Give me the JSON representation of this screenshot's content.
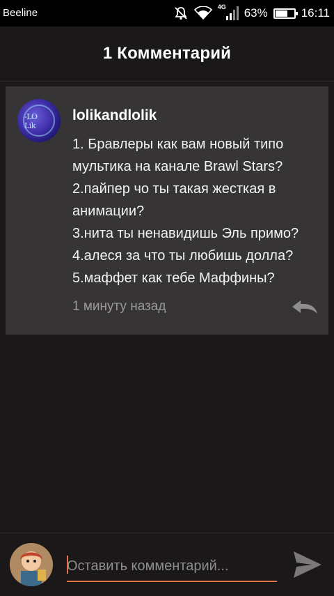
{
  "status_bar": {
    "carrier": "Beeline",
    "network_label": "4G",
    "battery_percent": "63%",
    "battery_level": 0.63,
    "time": "16:11",
    "icons": [
      "mute-icon",
      "wifi-icon",
      "signal-icon",
      "battery-icon"
    ]
  },
  "header": {
    "title": "1 Комментарий"
  },
  "comment": {
    "author": "lolikandlolik",
    "lines": [
      "1. Бравлеры как вам новый типо",
      "мультика на канале Brawl Stars?",
      "2.пайпер чо ты такая жесткая в",
      "анимации?",
      "3.нита ты ненавидишь Эль примо?",
      "4.алеся за что ты любишь долла?",
      "5.маффет как тебе Маффины?"
    ],
    "time": "1 минуту назад",
    "reply_icon": "reply-icon"
  },
  "composer": {
    "placeholder": "Оставить комментарий...",
    "value": "",
    "send_icon": "send-icon",
    "accent_color": "#e8714a"
  }
}
